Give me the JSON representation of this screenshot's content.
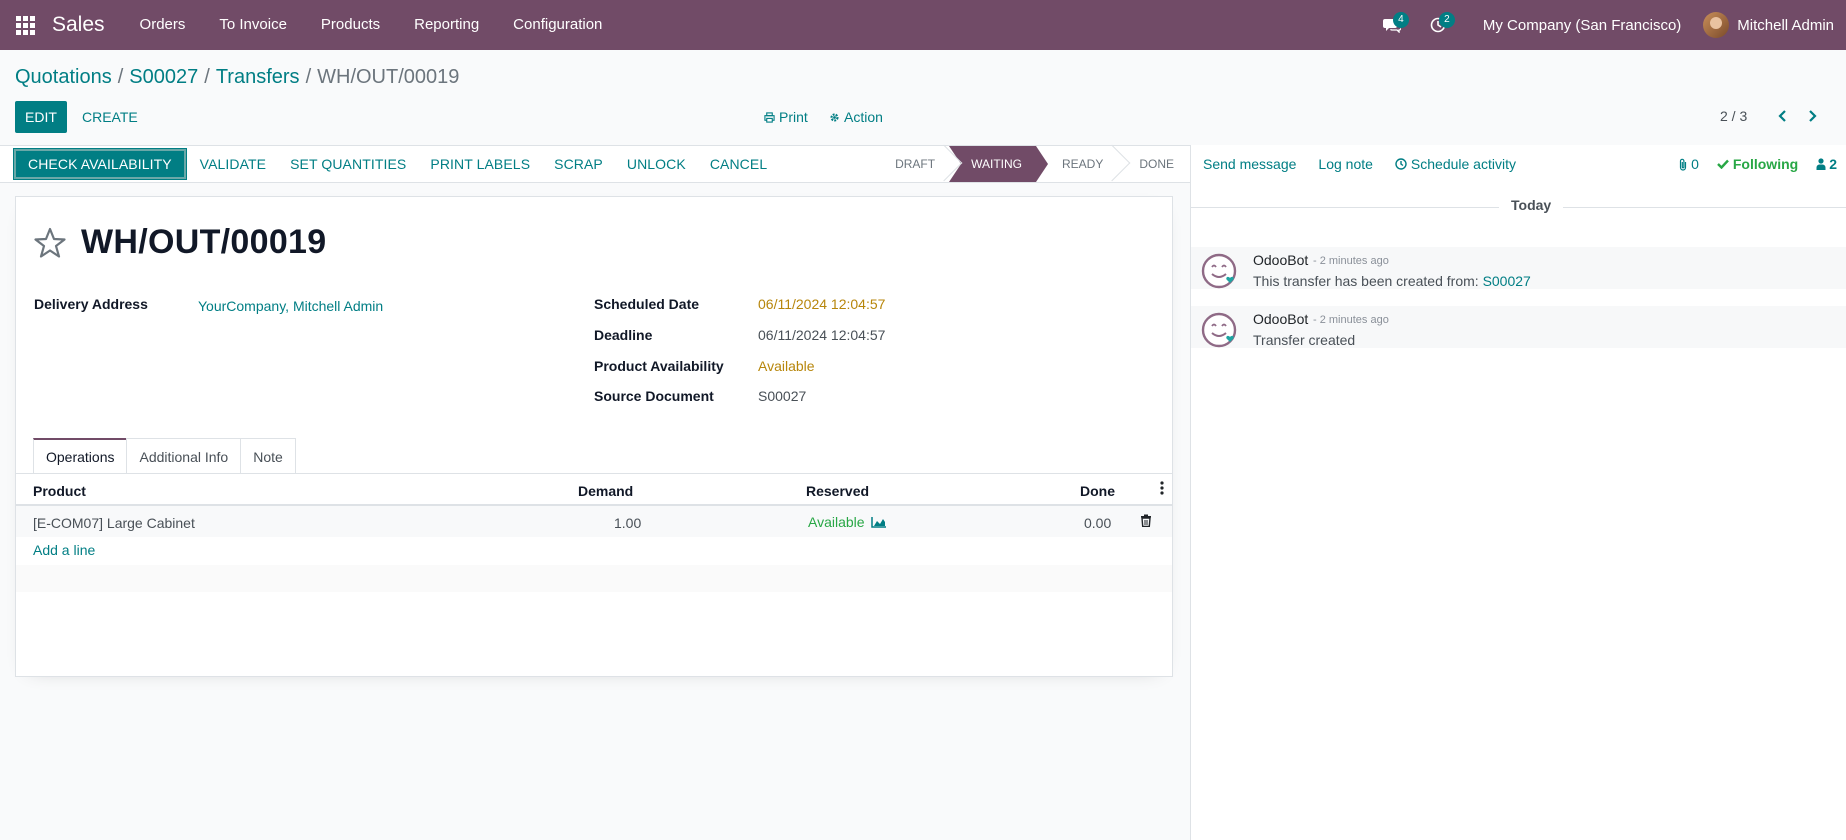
{
  "navbar": {
    "app_name": "Sales",
    "menu": [
      "Orders",
      "To Invoice",
      "Products",
      "Reporting",
      "Configuration"
    ],
    "messages_count": "4",
    "activities_count": "2",
    "company": "My Company (San Francisco)",
    "user": "Mitchell Admin"
  },
  "breadcrumb": {
    "items": [
      "Quotations",
      "S00027",
      "Transfers"
    ],
    "current": "WH/OUT/00019"
  },
  "control": {
    "edit_label": "EDIT",
    "create_label": "CREATE",
    "print_label": "Print",
    "action_label": "Action",
    "pager": "2 / 3"
  },
  "statusbar": {
    "buttons": [
      "CHECK AVAILABILITY",
      "VALIDATE",
      "SET QUANTITIES",
      "PRINT LABELS",
      "SCRAP",
      "UNLOCK",
      "CANCEL"
    ],
    "steps": [
      "DRAFT",
      "WAITING",
      "READY",
      "DONE"
    ],
    "active_step": "WAITING"
  },
  "form": {
    "title": "WH/OUT/00019",
    "delivery_address_label": "Delivery Address",
    "delivery_address_value": "YourCompany, Mitchell Admin",
    "scheduled_date_label": "Scheduled Date",
    "scheduled_date_value": "06/11/2024 12:04:57",
    "deadline_label": "Deadline",
    "deadline_value": "06/11/2024 12:04:57",
    "availability_label": "Product Availability",
    "availability_value": "Available",
    "source_label": "Source Document",
    "source_value": "S00027",
    "tabs": [
      "Operations",
      "Additional Info",
      "Note"
    ],
    "table": {
      "headers": [
        "Product",
        "Demand",
        "Reserved",
        "Done"
      ],
      "rows": [
        {
          "product": "[E-COM07] Large Cabinet",
          "demand": "1.00",
          "reserved": "Available",
          "done": "0.00"
        }
      ],
      "add_line": "Add a line"
    }
  },
  "chatter": {
    "send_message": "Send message",
    "log_note": "Log note",
    "schedule_activity": "Schedule activity",
    "attachments": "0",
    "following": "Following",
    "followers": "2",
    "date_separator": "Today",
    "messages": [
      {
        "author": "OdooBot",
        "time": "- 2 minutes ago",
        "body": "This transfer has been created from:",
        "link": "S00027"
      },
      {
        "author": "OdooBot",
        "time": "- 2 minutes ago",
        "body": "Transfer created",
        "link": ""
      }
    ]
  },
  "colors": {
    "brand": "#714b67",
    "accent": "#017e84",
    "success": "#28a745",
    "warning": "#b7860b"
  }
}
